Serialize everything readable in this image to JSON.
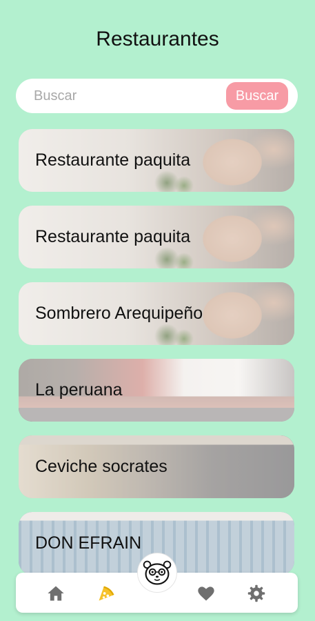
{
  "header": {
    "title": "Restaurantes"
  },
  "search": {
    "placeholder": "Buscar",
    "button_label": "Buscar"
  },
  "restaurants": [
    {
      "name": "Restaurante paquita",
      "image": "kitchen-photo"
    },
    {
      "name": "Restaurante paquita",
      "image": "kitchen-photo"
    },
    {
      "name": "Sombrero Arequipeño",
      "image": "kitchen-photo"
    },
    {
      "name": "La peruana",
      "image": "street-photo"
    },
    {
      "name": "Ceviche socrates",
      "image": "market-photo"
    },
    {
      "name": "DON EFRAIN",
      "image": "shop-photo"
    }
  ],
  "nav": {
    "items": [
      {
        "icon": "home-icon"
      },
      {
        "icon": "pizza-icon",
        "active": true
      },
      {
        "icon": "heart-icon"
      },
      {
        "icon": "gear-icon"
      }
    ],
    "center_button": {
      "icon": "panda-icon"
    }
  },
  "colors": {
    "background": "#b3f0cf",
    "search_button": "#f79ba5",
    "nav_active": "#f6c22a",
    "nav_inactive": "#6f6f6f"
  }
}
